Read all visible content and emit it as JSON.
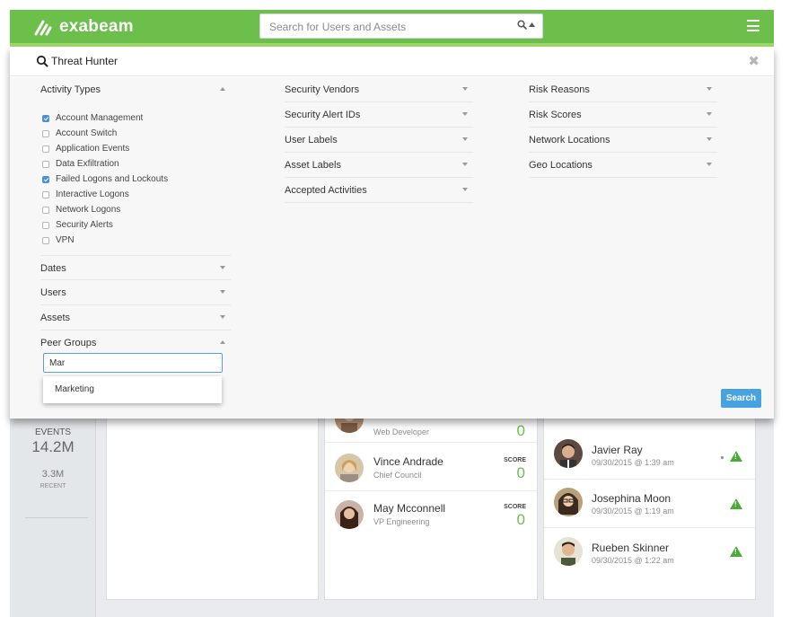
{
  "header": {
    "brand": "exabeam",
    "search_placeholder": "Search for Users and Assets",
    "search_icon": "search-icon",
    "menu_icon": "hamburger-menu-icon"
  },
  "threat_hunter": {
    "title": "Threat Hunter",
    "close_icon": "close-icon",
    "activity_types": {
      "label": "Activity Types",
      "items": [
        {
          "label": "Account Management",
          "checked": true
        },
        {
          "label": "Account Switch",
          "checked": false
        },
        {
          "label": "Application Events",
          "checked": false
        },
        {
          "label": "Data Exfiltration",
          "checked": false
        },
        {
          "label": "Failed Logons and Lockouts",
          "checked": true
        },
        {
          "label": "Interactive Logons",
          "checked": false
        },
        {
          "label": "Network Logons",
          "checked": false
        },
        {
          "label": "Security Alerts",
          "checked": false
        },
        {
          "label": "VPN",
          "checked": false
        }
      ]
    },
    "left_sections": [
      "Dates",
      "Users",
      "Assets",
      "Peer Groups"
    ],
    "middle_sections": [
      "Security Vendors",
      "Security Alert IDs",
      "User Labels",
      "Asset Labels",
      "Accepted Activities"
    ],
    "right_sections": [
      "Risk Reasons",
      "Risk Scores",
      "Network Locations",
      "Geo Locations"
    ],
    "peer_group_input": "Mar",
    "peer_group_suggestion": "Marketing",
    "search_button": "Search"
  },
  "dashboard": {
    "events_label": "EVENTS",
    "events_value": "14.2M",
    "recent_value": "3.3M",
    "recent_label": "RECENT",
    "users": [
      {
        "name": "",
        "title": "Web Developer",
        "score_label": "",
        "score": "0"
      },
      {
        "name": "Vince Andrade",
        "title": "Chief Council",
        "score_label": "SCORE",
        "score": "0"
      },
      {
        "name": "May Mcconnell",
        "title": "VP Engineering",
        "score_label": "SCORE",
        "score": "0"
      }
    ],
    "alerts": [
      {
        "name": "Javier Ray",
        "time": "09/30/2015 @ 1:39 am"
      },
      {
        "name": "Josephina Moon",
        "time": "09/30/2015 @ 1:19 am"
      },
      {
        "name": "Rueben Skinner",
        "time": "09/30/2015 @ 1:22 am"
      }
    ]
  },
  "colors": {
    "brand_green": "#6dbf4b",
    "accent_blue": "#46a3e0",
    "score_green": "#6dbf4b"
  }
}
